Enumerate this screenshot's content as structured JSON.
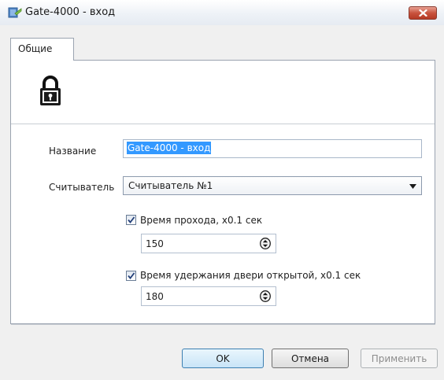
{
  "window": {
    "title": "Gate-4000 - вход",
    "close_label": "x"
  },
  "tabs": [
    {
      "label": "Общие"
    }
  ],
  "form": {
    "name_label": "Название",
    "name_value": "Gate-4000 - вход",
    "reader_label": "Считыватель",
    "reader_value": "Считыватель №1",
    "pass_time": {
      "checked": true,
      "label": "Время прохода, x0.1 сек",
      "value": "150"
    },
    "hold_time": {
      "checked": true,
      "label": "Время  удержания двери открытой, x0.1 сек",
      "value": "180"
    }
  },
  "buttons": {
    "ok": "OK",
    "cancel": "Отмена",
    "apply": "Применить"
  },
  "colors": {
    "selection": "#3399ff",
    "close_button": "#c9533e",
    "panel_border": "#9aa3b0"
  }
}
